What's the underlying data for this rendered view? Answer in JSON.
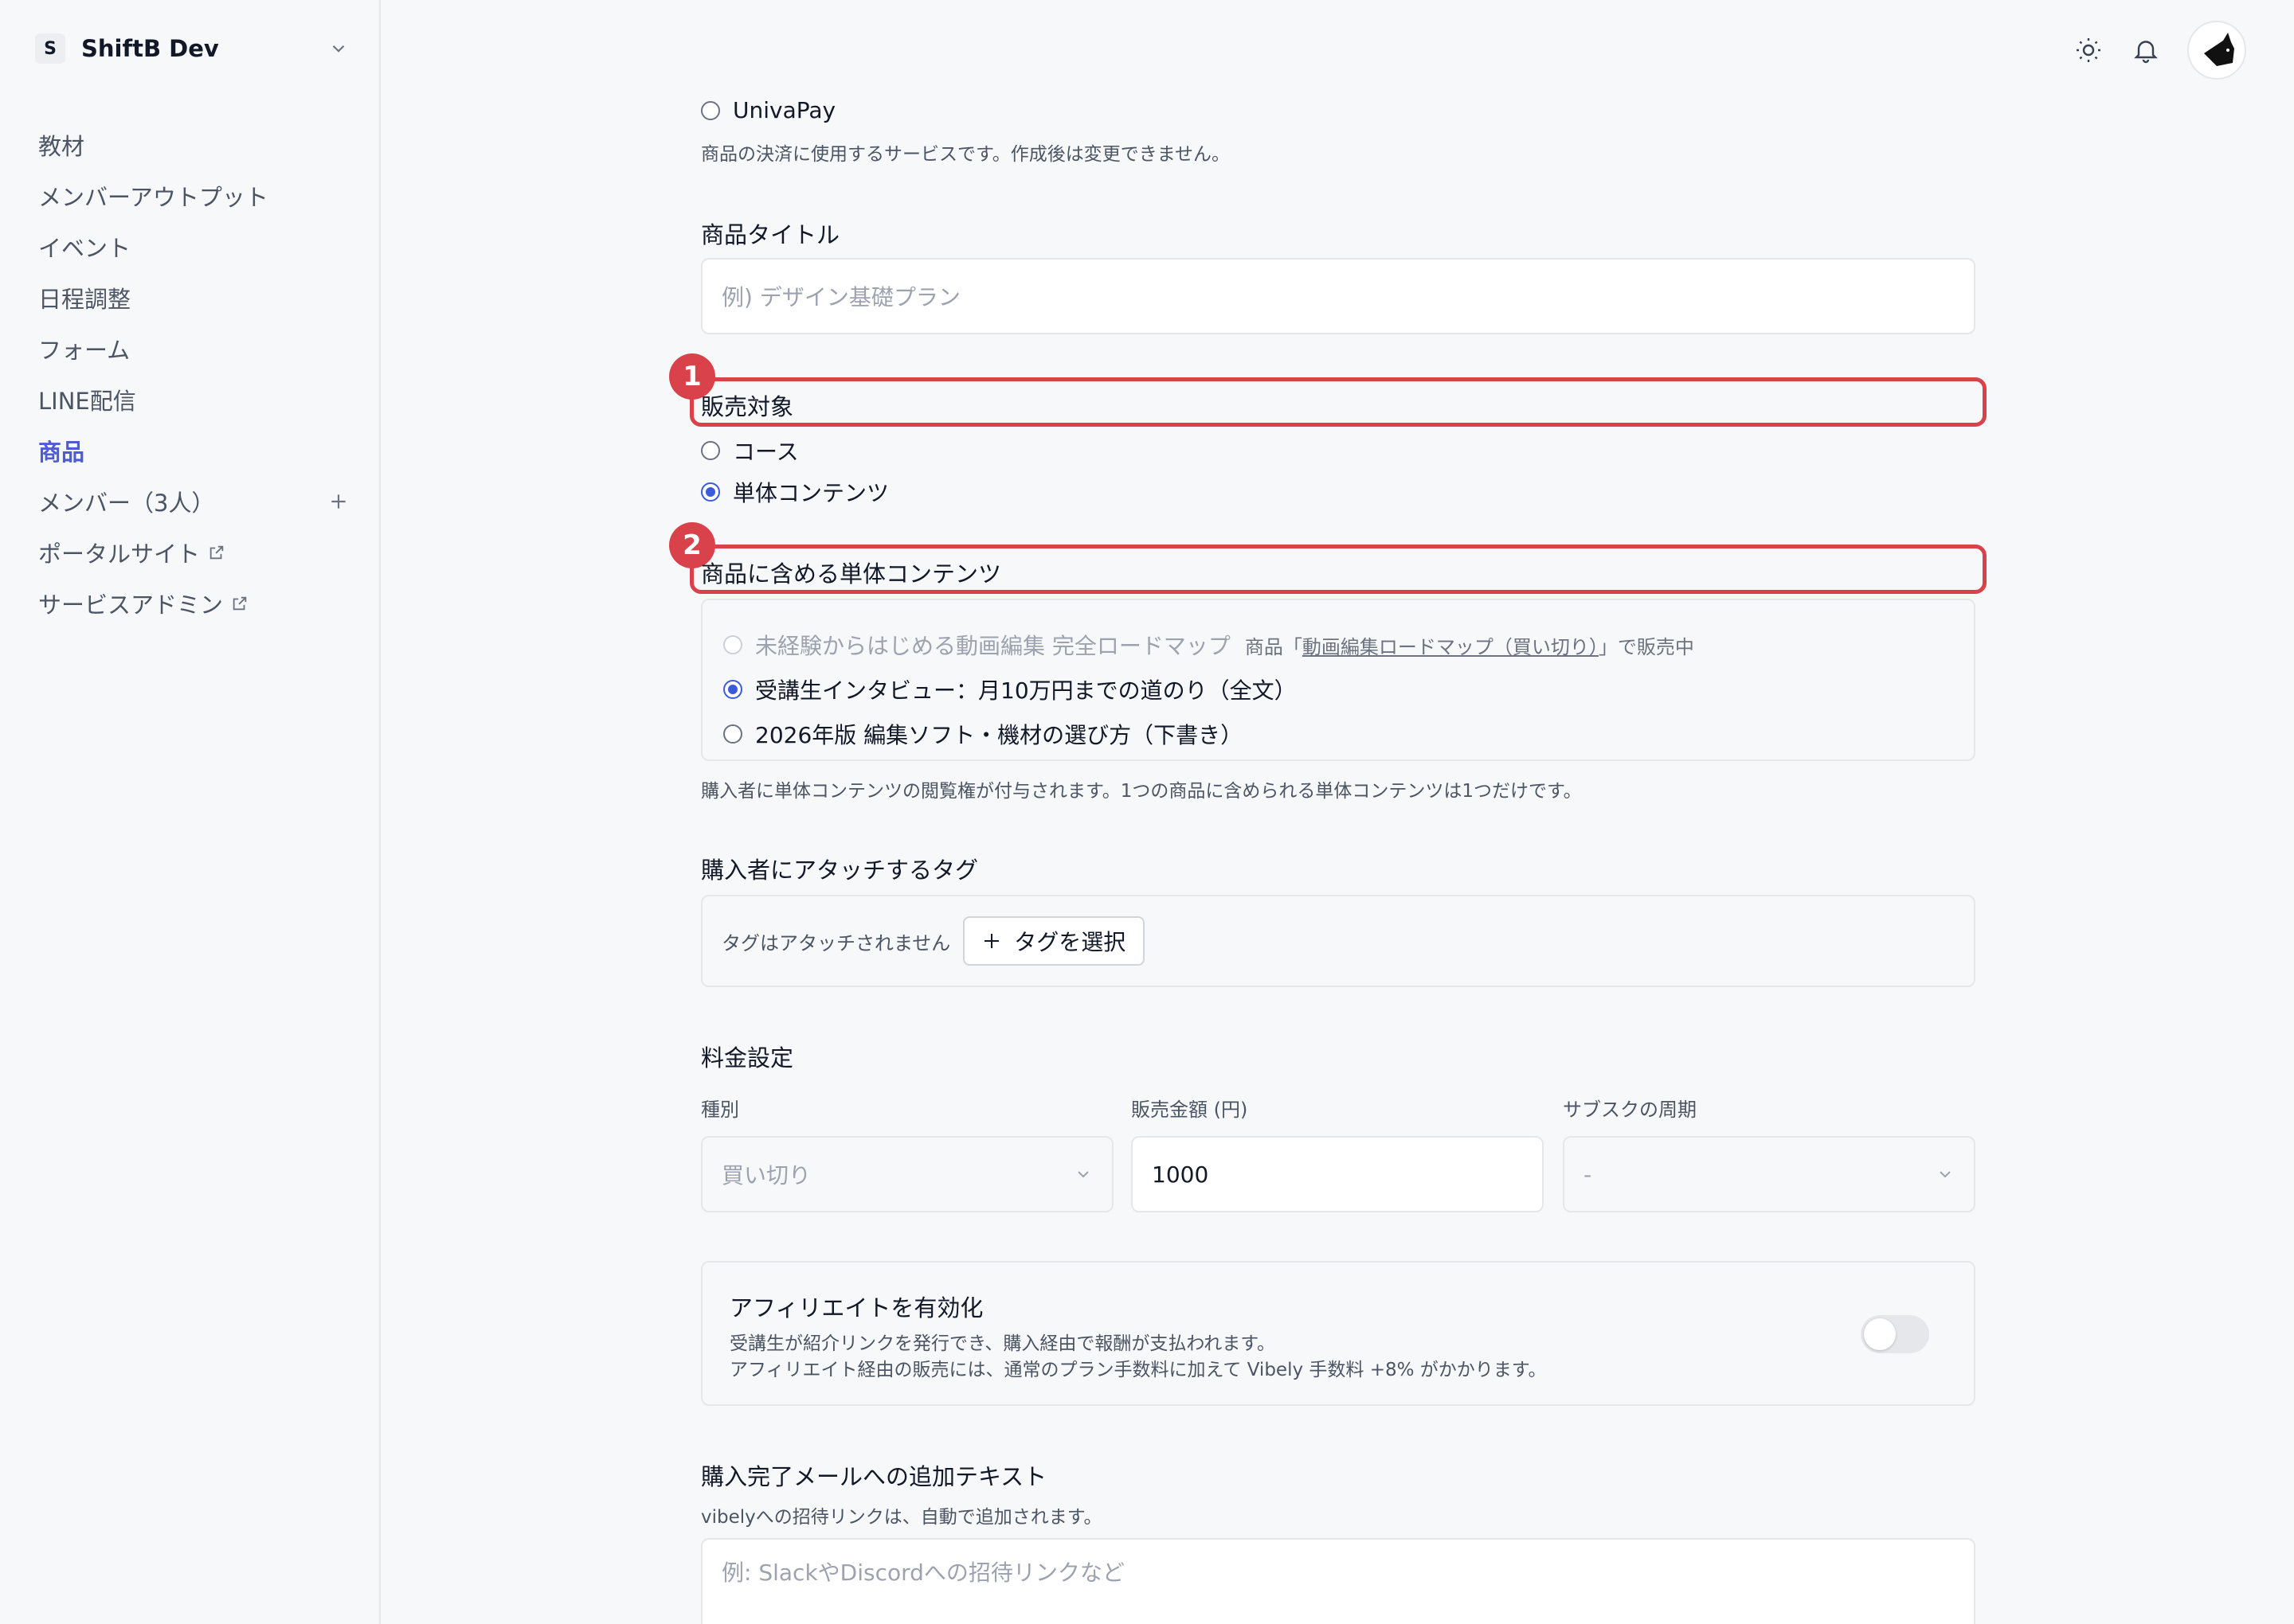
{
  "workspace": {
    "badge": "S",
    "name": "ShiftB Dev"
  },
  "sidebar": {
    "items": [
      {
        "label": "教材"
      },
      {
        "label": "メンバーアウトプット"
      },
      {
        "label": "イベント"
      },
      {
        "label": "日程調整"
      },
      {
        "label": "フォーム"
      },
      {
        "label": "LINE配信"
      },
      {
        "label": "商品",
        "active": true
      },
      {
        "label": "メンバー（3人）"
      },
      {
        "label": "ポータルサイト",
        "external": true
      },
      {
        "label": "サービスアドミン",
        "external": true
      }
    ]
  },
  "header": {
    "icons": [
      "sun-icon",
      "bell-icon",
      "avatar"
    ]
  },
  "payment": {
    "option": "UnivaPay",
    "help": "商品の決済に使用するサービスです。作成後は変更できません。"
  },
  "title_field": {
    "label": "商品タイトル",
    "placeholder": "例) デザイン基礎プラン"
  },
  "sale_target": {
    "label": "販売対象",
    "callout_number": "1",
    "options": [
      {
        "label": "コース",
        "checked": false
      },
      {
        "label": "単体コンテンツ",
        "checked": true
      }
    ]
  },
  "included_content": {
    "label": "商品に含める単体コンテンツ",
    "callout_number": "2",
    "options": [
      {
        "label": "未経験からはじめる動画編集 完全ロードマップ",
        "disabled": true,
        "note_prefix": "商品「",
        "note_link": "動画編集ロードマップ（買い切り）",
        "note_suffix": "」で販売中"
      },
      {
        "label": "受講生インタビュー：月10万円までの道のり（全文）",
        "checked": true
      },
      {
        "label": "2026年版 編集ソフト・機材の選び方（下書き）",
        "checked": false
      }
    ],
    "help": "購入者に単体コンテンツの閲覧権が付与されます。1つの商品に含められる単体コンテンツは1つだけです。"
  },
  "tags": {
    "label": "購入者にアタッチするタグ",
    "empty_note": "タグはアタッチされません",
    "button": "タグを選択"
  },
  "pricing": {
    "label": "料金設定",
    "type": {
      "label": "種別",
      "value": "買い切り"
    },
    "amount": {
      "label": "販売金額 (円)",
      "value": "1000"
    },
    "cycle": {
      "label": "サブスクの周期",
      "value": "-"
    }
  },
  "affiliate": {
    "title": "アフィリエイトを有効化",
    "desc1": "受講生が紹介リンクを発行でき、購入経由で報酬が支払われます。",
    "desc2": "アフィリエイト経由の販売には、通常のプラン手数料に加えて Vibely 手数料 +8% がかかります。",
    "enabled": false
  },
  "mail": {
    "label": "購入完了メールへの追加テキスト",
    "help": "vibelyへの招待リンクは、自動で追加されます。",
    "placeholder": "例: SlackやDiscordへの招待リンクなど"
  },
  "colors": {
    "accent": "#3b5bdb",
    "active_nav": "#4f5bd5",
    "callout": "#d9424a"
  }
}
